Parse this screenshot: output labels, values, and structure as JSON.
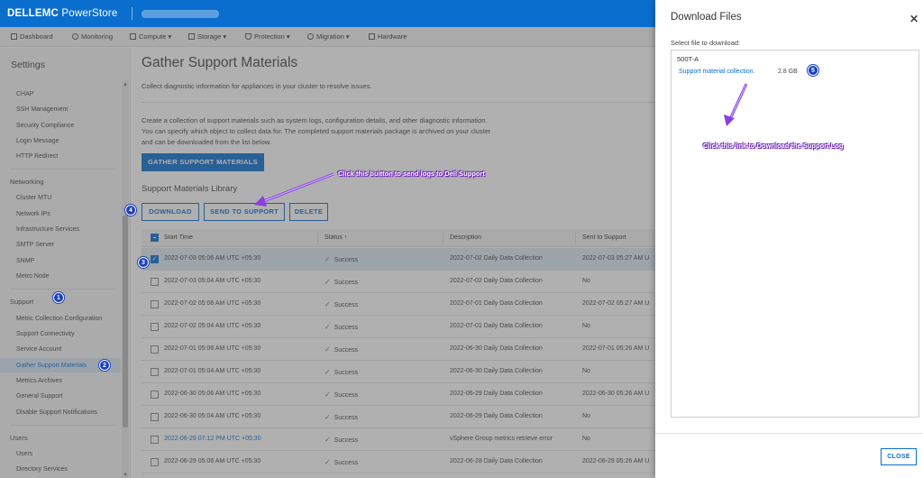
{
  "app": {
    "brand_dell": "DELLEMC",
    "brand_product": "PowerStore"
  },
  "nav": [
    "Dashboard",
    "Monitoring",
    "Compute ▾",
    "Storage ▾",
    "Protection ▾",
    "Migration ▾",
    "Hardware"
  ],
  "sidebar": {
    "title": "Settings",
    "items_top": [
      "CHAP",
      "SSH Management",
      "Security Compliance",
      "Login Message",
      "HTTP Redirect"
    ],
    "networking_head": "Networking",
    "networking": [
      "Cluster MTU",
      "Network IPs",
      "Infrastructure Services",
      "SMTP Server",
      "SNMP",
      "Metro Node"
    ],
    "support_head": "Support",
    "support": [
      "Metric Collection Configuration",
      "Support Connectivity",
      "Service Account",
      "Gather Support Materials",
      "Metrics Archives",
      "General Support",
      "Disable Support Notifications"
    ],
    "users_head": "Users",
    "users": [
      "Users",
      "Directory Services"
    ]
  },
  "main": {
    "title": "Gather Support Materials",
    "subtitle": "Collect diagnostic information for appliances in your cluster to resolve issues.",
    "desc1": "Create a collection of support materials such as system logs, configuration details, and other diagnostic information.",
    "desc2": "You can specify which object to collect data for. The completed support materials package is archived on your cluster",
    "desc3": "and can be downloaded from the list below.",
    "gather_button": "GATHER SUPPORT MATERIALS",
    "library_title": "Support Materials Library",
    "download_button": "DOWNLOAD",
    "send_button": "SEND TO SUPPORT",
    "delete_button": "DELETE",
    "columns": [
      "Start Time",
      "Status ↑",
      "Description",
      "Sent to Support"
    ],
    "rows": [
      {
        "start": "2022-07-03 05:06 AM UTC +05:30",
        "status": "Success",
        "desc": "2022-07-02 Daily Data Collection",
        "sent": "2022-07-03 05:27 AM U"
      },
      {
        "start": "2022-07-03 05:04 AM UTC +05:30",
        "status": "Success",
        "desc": "2022-07-02 Daily Data Collection",
        "sent": "No"
      },
      {
        "start": "2022-07-02 05:06 AM UTC +05:30",
        "status": "Success",
        "desc": "2022-07-01 Daily Data Collection",
        "sent": "2022-07-02 05:27 AM U"
      },
      {
        "start": "2022-07-02 05:04 AM UTC +05:30",
        "status": "Success",
        "desc": "2022-07-01 Daily Data Collection",
        "sent": "No"
      },
      {
        "start": "2022-07-01 05:06 AM UTC +05:30",
        "status": "Success",
        "desc": "2022-06-30 Daily Data Collection",
        "sent": "2022-07-01 05:26 AM U"
      },
      {
        "start": "2022-07-01 05:04 AM UTC +05:30",
        "status": "Success",
        "desc": "2022-06-30 Daily Data Collection",
        "sent": "No"
      },
      {
        "start": "2022-06-30 05:06 AM UTC +05:30",
        "status": "Success",
        "desc": "2022-06-29 Daily Data Collection",
        "sent": "2022-06-30 05:26 AM U"
      },
      {
        "start": "2022-06-30 05:04 AM UTC +05:30",
        "status": "Success",
        "desc": "2022-06-29 Daily Data Collection",
        "sent": "No"
      },
      {
        "start": "2022-06-29 07:12 PM UTC +05:30",
        "status": "Success",
        "desc": "vSphere Group metrics retrieve error",
        "sent": "No"
      },
      {
        "start": "2022-06-29 05:06 AM UTC +05:30",
        "status": "Success",
        "desc": "2022-06-28 Daily Data Collection",
        "sent": "2022-06-29 05:26 AM U"
      }
    ]
  },
  "modal": {
    "title": "Download Files",
    "close_x": "✕",
    "label": "Select file to download:",
    "appliance": "500T-A",
    "link": "Support material collection.",
    "size": "2.8 GB",
    "close_button": "CLOSE"
  },
  "annotations": {
    "note_send": "Click this buitton to send logs to Dell Support",
    "note_download": "Click this link to Download the Support Log",
    "badges": [
      "1",
      "2",
      "3",
      "4",
      "5"
    ]
  }
}
